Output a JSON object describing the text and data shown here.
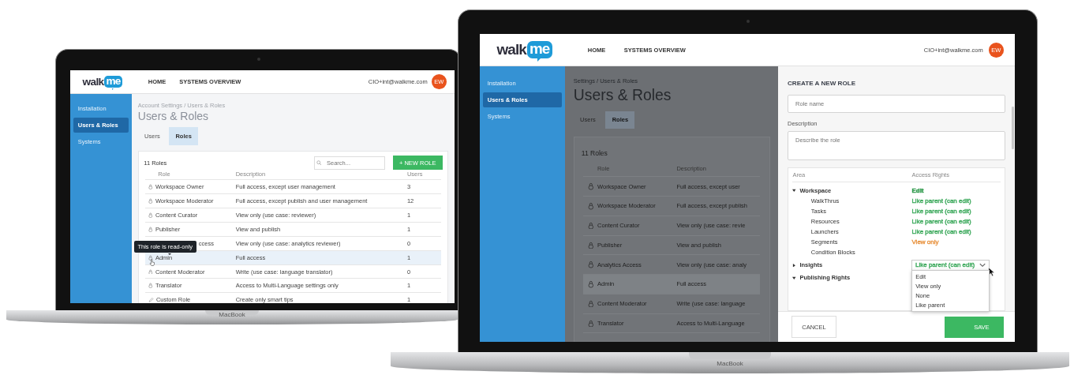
{
  "laptops": [
    {
      "brand": "MacBook",
      "screen": {
        "header": {
          "logo": [
            "walk",
            "me"
          ],
          "nav": [
            "HOME",
            "SYSTEMS OVERVIEW"
          ],
          "user_email": "CIO+int@walkme.com",
          "avatar": "EW"
        },
        "sidebar": [
          {
            "label": "Installation",
            "selected": false
          },
          {
            "label": "Users & Roles",
            "selected": true
          },
          {
            "label": "Systems",
            "selected": false
          }
        ],
        "dimmed": false,
        "breadcrumb": "Account Settings / Users & Roles",
        "page_title": "Users & Roles",
        "tabs": [
          {
            "label": "Users",
            "selected": false
          },
          {
            "label": "Roles",
            "selected": true
          }
        ],
        "roles_count": "11 Roles",
        "search": {
          "placeholder": "Search..."
        },
        "new_role_button": "+ NEW ROLE",
        "table": {
          "columns": [
            "Role",
            "Description",
            "Users"
          ],
          "rows": [
            {
              "kind": "locked",
              "role": "Workspace Owner",
              "description": "Full access, except user management",
              "users": "3",
              "selected": false,
              "hovered": false
            },
            {
              "kind": "locked",
              "role": "Workspace Moderator",
              "description": "Full access, except publish and user management",
              "users": "12",
              "selected": false,
              "hovered": false
            },
            {
              "kind": "locked",
              "role": "Content Curator",
              "description": "View only (use case: reviewer)",
              "users": "1",
              "selected": false,
              "hovered": false
            },
            {
              "kind": "locked",
              "role": "Publisher",
              "description": "View and publish",
              "users": "1",
              "selected": false,
              "hovered": false
            },
            {
              "kind": "locked",
              "role": "ccess",
              "tooltip": "This role is read-only",
              "description": "View only (use case: analytics reviewer)",
              "users": "0",
              "selected": false,
              "hovered": false
            },
            {
              "kind": "locked",
              "role": "Admin",
              "description": "Full access",
              "users": "1",
              "selected": true,
              "hovered": true
            },
            {
              "kind": "locked",
              "role": "Content Moderator",
              "description": "Write (use case: language translator)",
              "users": "0",
              "selected": false,
              "hovered": false
            },
            {
              "kind": "locked",
              "role": "Translator",
              "description": "Access to Multi-Language settings only",
              "users": "1",
              "selected": false,
              "hovered": false
            },
            {
              "kind": "editable",
              "role": "Custom Role",
              "description": "Create only smart tips",
              "users": "1",
              "selected": false,
              "hovered": false
            }
          ]
        }
      }
    },
    {
      "brand": "MacBook",
      "screen": {
        "header": {
          "logo": [
            "walk",
            "me"
          ],
          "nav": [
            "HOME",
            "SYSTEMS OVERVIEW"
          ],
          "user_email": "CIO+int@walkme.com",
          "avatar": "EW"
        },
        "sidebar": [
          {
            "label": "Installation",
            "selected": false
          },
          {
            "label": "Users & Roles",
            "selected": true
          },
          {
            "label": "Systems",
            "selected": false
          }
        ],
        "dimmed": true,
        "breadcrumb": "Settings / Users & Roles",
        "page_title": "Users & Roles",
        "tabs": [
          {
            "label": "Users",
            "selected": false
          },
          {
            "label": "Roles",
            "selected": true
          }
        ],
        "roles_count": "11 Roles",
        "table": {
          "columns": [
            "Role",
            "Description"
          ],
          "rows": [
            {
              "kind": "locked",
              "role": "Workspace Owner",
              "description": "Full access, except user",
              "selected": false,
              "hovered": false
            },
            {
              "kind": "locked",
              "role": "Workspace Moderator",
              "description": "Full access, except publish",
              "selected": false,
              "hovered": false
            },
            {
              "kind": "locked",
              "role": "Content Curator",
              "description": "View only (use case: revie",
              "selected": false,
              "hovered": false
            },
            {
              "kind": "locked",
              "role": "Publisher",
              "description": "View and publish",
              "selected": false,
              "hovered": false
            },
            {
              "kind": "locked",
              "role": "Analytics Access",
              "description": "View only (use case: analy",
              "selected": false,
              "hovered": false
            },
            {
              "kind": "locked",
              "role": "Admin",
              "description": "Full access",
              "selected": true,
              "hovered": false
            },
            {
              "kind": "locked",
              "role": "Content Moderator",
              "description": "Write (use case: language",
              "selected": false,
              "hovered": false
            },
            {
              "kind": "locked",
              "role": "Translator",
              "description": "Access to Multi-Language",
              "selected": false,
              "hovered": false
            }
          ]
        },
        "panel": {
          "title": "CREATE A NEW ROLE",
          "name_field": {
            "placeholder": "Role name"
          },
          "description_label": "Description",
          "description_field": {
            "placeholder": "Describe the role"
          },
          "access_table": {
            "columns": [
              "Area",
              "Access Rights"
            ],
            "areas": [
              {
                "label": "Workspace",
                "expanded": true,
                "access": {
                  "kind": "text",
                  "label": "Edit",
                  "color": "#2f9a4c"
                },
                "children": [
                  {
                    "label": "WalkThrus",
                    "access": {
                      "kind": "text",
                      "label": "Like parent (can edit)",
                      "color": "#3aa85a"
                    }
                  },
                  {
                    "label": "Tasks",
                    "access": {
                      "kind": "text",
                      "label": "Like parent (can edit)",
                      "color": "#3aa85a"
                    }
                  },
                  {
                    "label": "Resources",
                    "access": {
                      "kind": "text",
                      "label": "Like parent (can edit)",
                      "color": "#3aa85a"
                    }
                  },
                  {
                    "label": "Launchers",
                    "access": {
                      "kind": "text",
                      "label": "Like parent (can edit)",
                      "color": "#3aa85a"
                    }
                  },
                  {
                    "label": "Segments",
                    "access": {
                      "kind": "text",
                      "label": "View only",
                      "color": "#e8923e"
                    }
                  },
                  {
                    "label": "Condition Blocks"
                  }
                ]
              },
              {
                "label": "Insights",
                "expanded": false,
                "access": {
                  "kind": "dropdown",
                  "label": "Like parent (can edit)",
                  "color": "#3aa85a",
                  "expanded": true,
                  "options": [
                    "Edit",
                    "View only",
                    "None",
                    "Like parent"
                  ]
                }
              },
              {
                "label": "Publishing Rights",
                "expanded": true
              }
            ]
          },
          "cancel_button": "CANCEL",
          "save_button": "SAVE"
        }
      }
    }
  ]
}
